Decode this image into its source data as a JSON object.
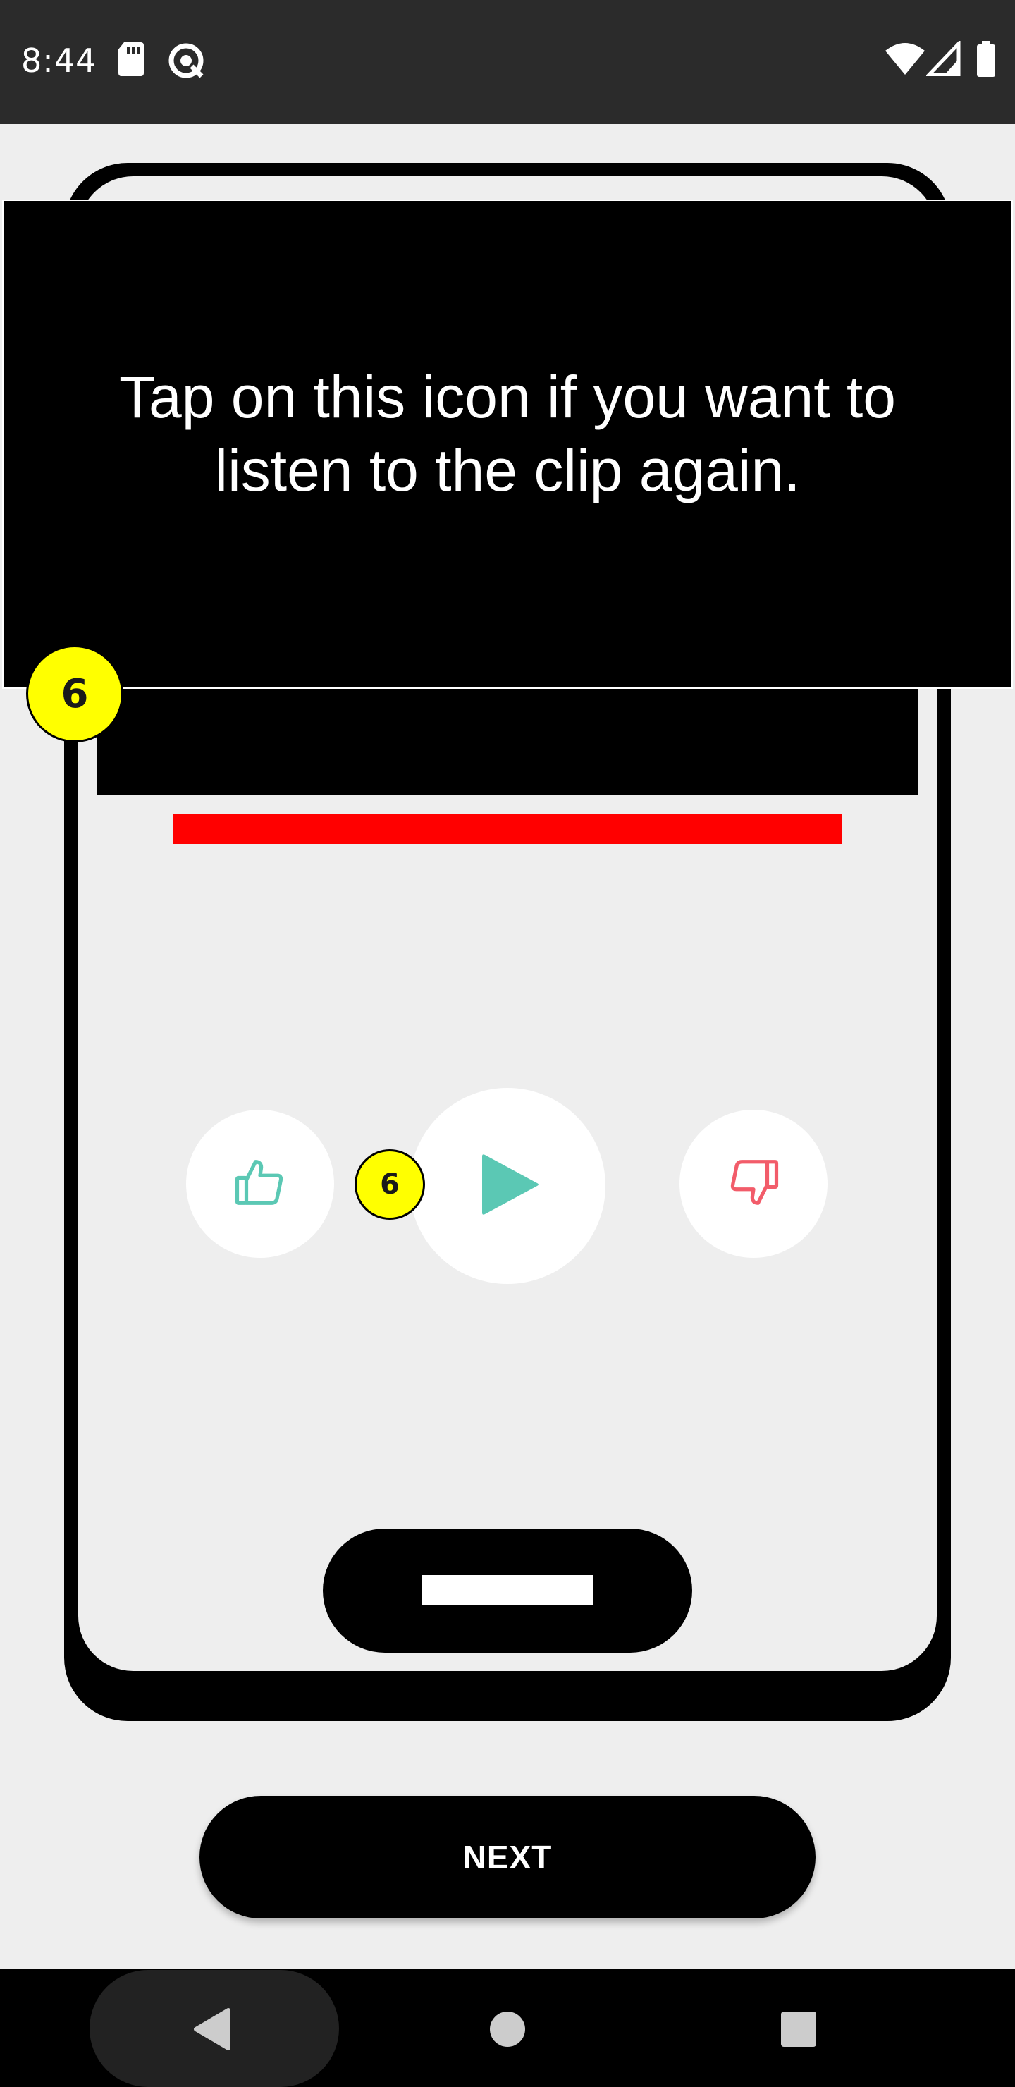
{
  "status_bar": {
    "time": "8:44",
    "icons": [
      "sd-card-icon",
      "data-saver-icon",
      "wifi-icon",
      "signal-icon",
      "battery-icon"
    ]
  },
  "tooltip": {
    "text": "Tap on this icon if you want to listen to the clip again."
  },
  "step_badges": {
    "large": "6",
    "small": "6"
  },
  "player": {
    "icons": [
      "thumbs-up-icon",
      "play-icon",
      "thumbs-down-icon"
    ]
  },
  "next_button": {
    "label": "NEXT"
  },
  "nav_bar": {
    "icons": [
      "back-icon",
      "home-icon",
      "recents-icon"
    ]
  },
  "colors": {
    "accent_teal": "#5bc8b4",
    "accent_red": "#f25c6a",
    "highlight_yellow": "#ffff00",
    "progress_red": "#ff0000"
  }
}
